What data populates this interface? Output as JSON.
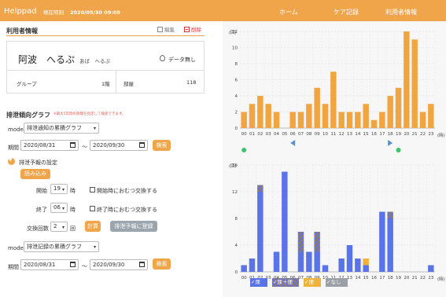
{
  "header": {
    "app_name": "Helppad",
    "clock_label": "現在時刻",
    "clock_value": "2020/09/30 09:08",
    "nav": [
      "ホーム",
      "ケア記録",
      "利用者情報"
    ]
  },
  "user_info": {
    "section_title": "利用者情報",
    "edit_label": "編集",
    "delete_label": "削除",
    "name": "阿波　へるぷ",
    "kana": "あば　へるぷ",
    "data_status": "データ無し",
    "group_label": "グループ",
    "group_value": "1階",
    "room_label": "部屋",
    "room_value": "118"
  },
  "trend": {
    "section_title": "排泄傾向グラフ",
    "note": "※最大5年間の期間を指定して検索できます。",
    "mode_label": "mode",
    "mode_value": "排泄通知の累積グラフ",
    "period_label": "期間",
    "date_from": "2020/08/31",
    "date_to": "2020/09/30",
    "tilde": "〜",
    "search_label": "検索"
  },
  "forecast": {
    "toggle_label": "排泄予報の設定",
    "load_label": "読み込み",
    "start_label": "開始",
    "start_value": "19",
    "end_label": "終了",
    "end_value": "06",
    "hour_unit": "時",
    "start_check_label": "開始時におむつ交換する",
    "end_check_label": "終了時におむつ交換する",
    "count_label": "交換回数",
    "count_value": "2",
    "count_unit": "回",
    "calc_label": "計算",
    "register_label": "排泄予報に登録"
  },
  "record": {
    "mode_label": "mode",
    "mode_value": "排泄記録の累積グラフ",
    "period_label": "期間",
    "date_from": "2020/08/31",
    "date_to": "2020/09/30",
    "tilde": "〜",
    "search_label": "検索"
  },
  "chart_data": [
    {
      "type": "bar",
      "title": "",
      "ylabel": "(回)",
      "xlabel": "(時)",
      "ylim": [
        0,
        12
      ],
      "yticks": [
        "0",
        "2",
        "4",
        "6",
        "8",
        "10",
        "12"
      ],
      "categories": [
        "00",
        "01",
        "02",
        "03",
        "04",
        "05",
        "06",
        "07",
        "08",
        "09",
        "10",
        "11",
        "12",
        "13",
        "14",
        "15",
        "16",
        "17",
        "18",
        "19",
        "20",
        "21",
        "22",
        "23"
      ],
      "values": [
        2,
        3,
        4,
        3,
        2,
        0,
        2,
        2,
        3,
        5,
        3,
        7,
        2,
        2,
        2,
        3,
        1,
        2,
        4,
        5,
        12,
        11,
        2,
        3
      ],
      "color": "#f0a540",
      "markers": {
        "green_dots": [
          "00",
          "19"
        ],
        "left_arrow": "06",
        "right_arrow": "18"
      }
    },
    {
      "type": "bar",
      "title": "",
      "ylabel": "(回)",
      "xlabel": "(時)",
      "ylim": [
        0,
        16
      ],
      "yticks": [
        "0",
        "4",
        "8",
        "12",
        "16"
      ],
      "categories": [
        "00",
        "01",
        "02",
        "03",
        "04",
        "05",
        "06",
        "07",
        "08",
        "09",
        "10",
        "11",
        "12",
        "13",
        "14",
        "15",
        "16",
        "17",
        "18",
        "19",
        "20",
        "21",
        "22",
        "23"
      ],
      "stacked": true,
      "series": [
        {
          "name": "尿",
          "color": "#5a74e8",
          "values": [
            1,
            2,
            12,
            0,
            3,
            15,
            0,
            3,
            3,
            3,
            1,
            0,
            2,
            4,
            2,
            1,
            0,
            9,
            8,
            0,
            0,
            0,
            0,
            1
          ]
        },
        {
          "name": "尿＋便",
          "color": "#9a7a5a",
          "values": [
            0,
            0,
            1,
            0,
            0,
            0,
            0,
            3,
            0,
            3,
            0,
            0,
            0,
            0,
            0,
            0,
            0,
            0,
            1,
            0,
            0,
            0,
            0,
            0
          ]
        },
        {
          "name": "便",
          "color": "#f0b23a",
          "values": [
            0,
            0,
            0,
            0,
            0,
            0,
            0,
            0,
            0,
            0,
            0,
            0,
            0,
            0,
            0,
            1,
            0,
            0,
            0,
            0,
            0,
            0,
            0,
            0
          ]
        },
        {
          "name": "なし",
          "color": "#9aa0a6",
          "values": [
            0,
            0,
            0,
            0,
            0,
            0,
            0,
            0,
            0,
            0,
            0,
            0,
            0,
            0,
            0,
            0,
            0,
            0,
            0,
            0,
            0,
            0,
            0,
            0
          ]
        }
      ]
    }
  ]
}
